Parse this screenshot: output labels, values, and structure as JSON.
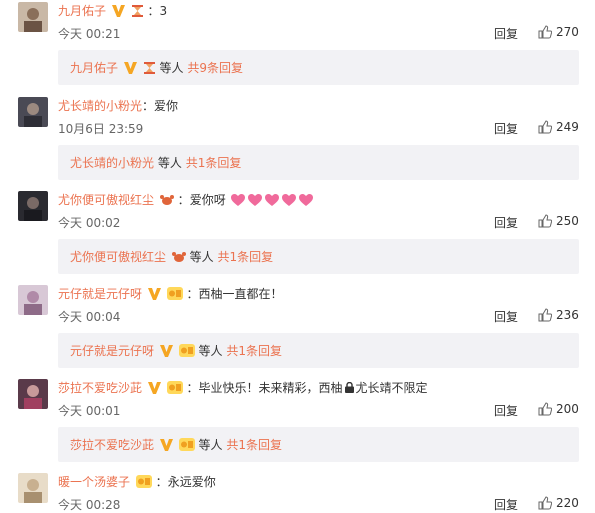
{
  "comments": [
    {
      "user": "九月佑子",
      "text": "3",
      "time": "今天 00:21",
      "reply_label": "回复",
      "likes": "270",
      "sub_user": "九月佑子",
      "sub_others": "等人",
      "sub_count": "共9条回复"
    },
    {
      "user": "尤长靖的小粉光",
      "text": "爱你",
      "time": "10月6日 23:59",
      "reply_label": "回复",
      "likes": "249",
      "sub_user": "尤长靖的小粉光",
      "sub_others": "等人",
      "sub_count": "共1条回复"
    },
    {
      "user": "尤你便可傲视红尘",
      "text": "爱你呀",
      "time": "今天 00:02",
      "reply_label": "回复",
      "likes": "250",
      "sub_user": "尤你便可傲视红尘",
      "sub_others": "等人",
      "sub_count": "共1条回复"
    },
    {
      "user": "元仔就是元仔呀",
      "text": "西柚一直都在！",
      "time": "今天 00:04",
      "reply_label": "回复",
      "likes": "236",
      "sub_user": "元仔就是元仔呀",
      "sub_others": "等人",
      "sub_count": "共1条回复"
    },
    {
      "user": "莎拉不爱吃沙茈",
      "text": "毕业快乐！未来精彩，西柚",
      "text2": "尤长靖不限定",
      "time": "今天 00:01",
      "reply_label": "回复",
      "likes": "200",
      "sub_user": "莎拉不爱吃沙茈",
      "sub_others": "等人",
      "sub_count": "共1条回复"
    },
    {
      "user": "暖一个汤婆子",
      "text": "永远爱你",
      "time": "今天 00:28",
      "reply_label": "回复",
      "likes": "220"
    }
  ],
  "colors": {
    "username": "#eb7350",
    "subbg": "#f2f2f5",
    "vbadge": "#f5a623"
  }
}
